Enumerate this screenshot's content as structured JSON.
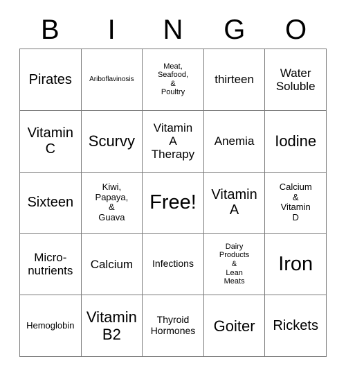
{
  "card": {
    "title_letters": [
      "B",
      "I",
      "N",
      "G",
      "O"
    ],
    "free_space_label": "Free!",
    "grid_rows": 5,
    "grid_columns": 5,
    "colors": {
      "background": "#ffffff",
      "text": "#000000",
      "border": "#7a7a7a"
    },
    "cells": [
      [
        {
          "text": "Pirates",
          "size": "lg"
        },
        {
          "text": "Ariboflavinosis",
          "size": "tiny"
        },
        {
          "text": "Meat,\nSeafood,\n&\nPoultry",
          "size": "xxs"
        },
        {
          "text": "thirteen",
          "size": "md"
        },
        {
          "text": "Water\nSoluble",
          "size": "md"
        }
      ],
      [
        {
          "text": "Vitamin\nC",
          "size": "lg"
        },
        {
          "text": "Scurvy",
          "size": "xl"
        },
        {
          "text": "Vitamin\nA\nTherapy",
          "size": "md"
        },
        {
          "text": "Anemia",
          "size": "md"
        },
        {
          "text": "Iodine",
          "size": "xl"
        }
      ],
      [
        {
          "text": "Sixteen",
          "size": "lg"
        },
        {
          "text": "Kiwi,\nPapaya,\n&\nGuava",
          "size": "xs"
        },
        {
          "text": "Free!",
          "size": "xxl"
        },
        {
          "text": "Vitamin\nA",
          "size": "lg"
        },
        {
          "text": "Calcium\n&\nVitamin\nD",
          "size": "xs"
        }
      ],
      [
        {
          "text": "Micro-\nnutrients",
          "size": "md"
        },
        {
          "text": "Calcium",
          "size": "md"
        },
        {
          "text": "Infections",
          "size": "sm"
        },
        {
          "text": "Dairy\nProducts\n&\nLean\nMeats",
          "size": "xxs"
        },
        {
          "text": "Iron",
          "size": "xxl"
        }
      ],
      [
        {
          "text": "Hemoglobin",
          "size": "xs"
        },
        {
          "text": "Vitamin\nB2",
          "size": "xl"
        },
        {
          "text": "Thyroid\nHormones",
          "size": "sm"
        },
        {
          "text": "Goiter",
          "size": "xl"
        },
        {
          "text": "Rickets",
          "size": "lg"
        }
      ]
    ]
  }
}
